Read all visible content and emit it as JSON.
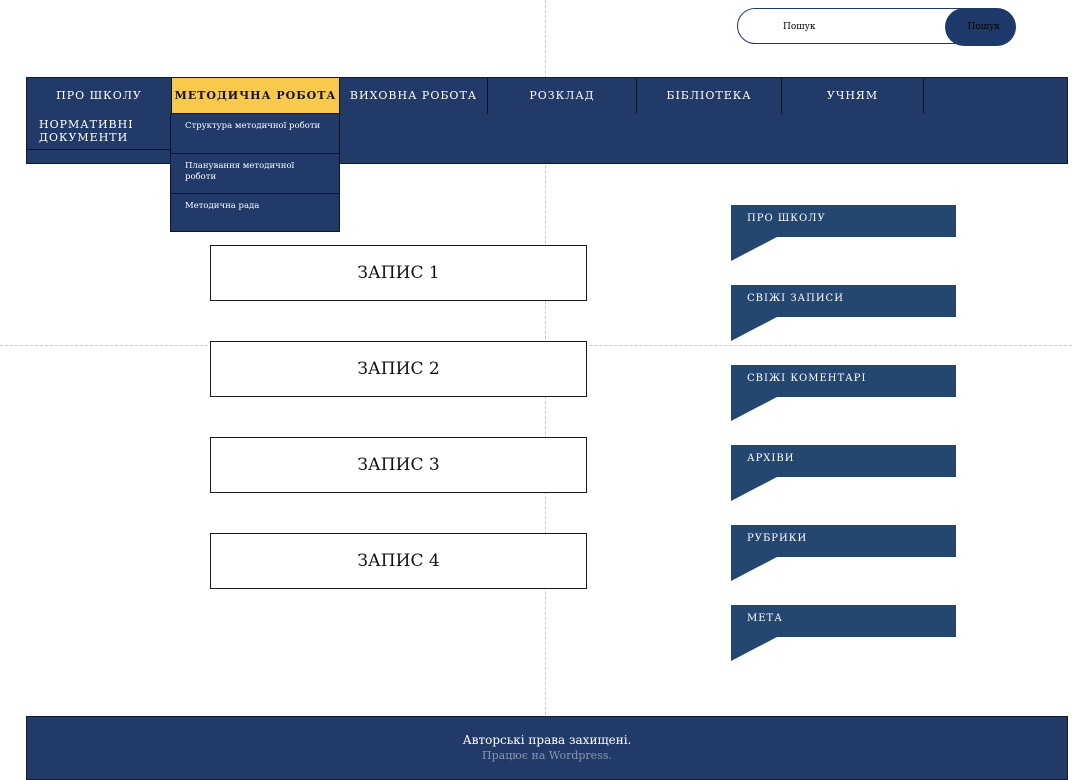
{
  "search": {
    "placeholder": "Пошук",
    "button_label": "Пошук"
  },
  "nav": {
    "items": [
      {
        "label": "ПРО ШКОЛУ"
      },
      {
        "label": "МЕТОДИЧНА РОБОТА",
        "active": true
      },
      {
        "label": "ВИХОВНА РОБОТА"
      },
      {
        "label": "РОЗКЛАД"
      },
      {
        "label": "БІБЛІОТЕКА"
      },
      {
        "label": "УЧНЯМ"
      }
    ],
    "second_row": [
      "НОРМАТИВНІ",
      "ДОКУМЕНТИ"
    ],
    "dropdown": [
      {
        "label": "Структура методичної роботи"
      },
      {
        "label": "Планування методичної роботи"
      },
      {
        "label": "Методична рада"
      }
    ]
  },
  "posts": [
    "ЗАПИС 1",
    "ЗАПИС 2",
    "ЗАПИС 3",
    "ЗАПИС 4"
  ],
  "widgets": [
    "ПРО ШКОЛУ",
    "СВІЖІ ЗАПИСИ",
    "СВІЖІ КОМЕНТАРІ",
    "АРХІВИ",
    "РУБРИКИ",
    "МЕТА"
  ],
  "footer": {
    "copyright": "Авторські права захищені.",
    "powered": "Працює на Wordpress."
  },
  "colors": {
    "navy": "#213a67",
    "active": "#f8c94d",
    "widget": "#24476f"
  }
}
